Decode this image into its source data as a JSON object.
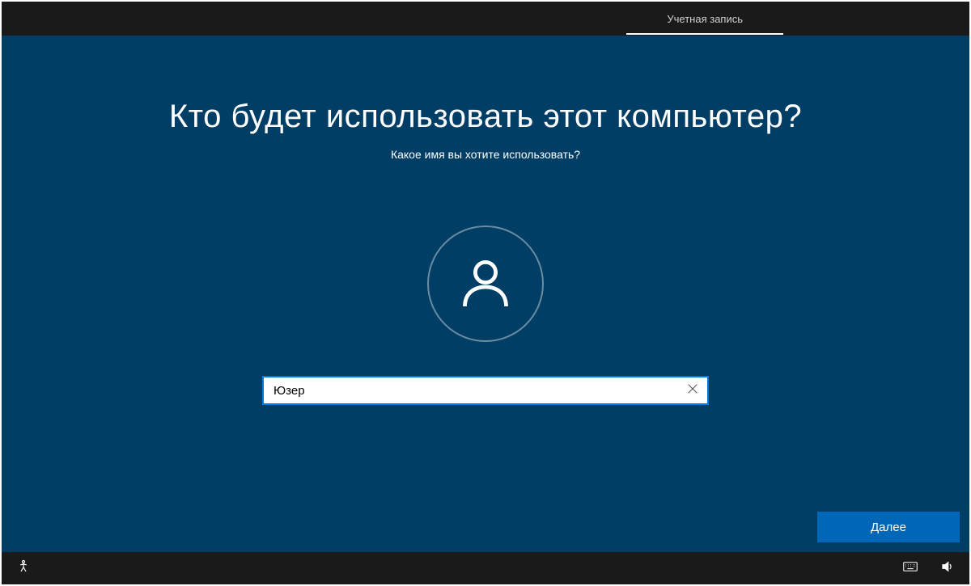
{
  "header": {
    "tab_label": "Учетная запись"
  },
  "main": {
    "title": "Кто будет использовать этот компьютер?",
    "subtitle": "Какое имя вы хотите использовать?",
    "username_value": "Юзер",
    "next_label": "Далее"
  },
  "icons": {
    "user": "user-icon",
    "clear": "close-icon",
    "accessibility": "accessibility-icon",
    "keyboard": "keyboard-icon",
    "volume": "volume-icon"
  }
}
